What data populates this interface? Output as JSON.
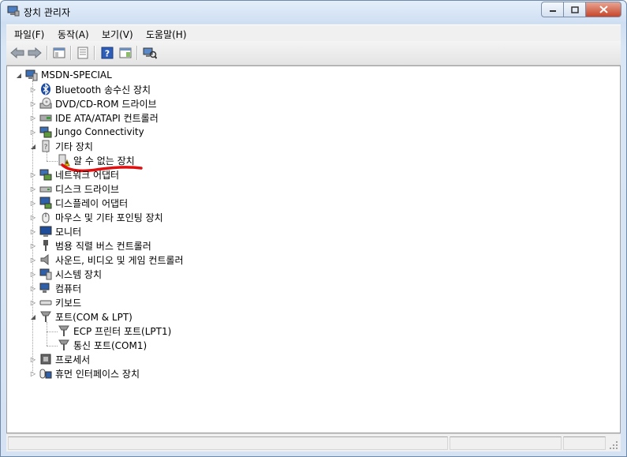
{
  "window": {
    "title": "장치 관리자",
    "btn_min": "0",
    "btn_max": "1",
    "btn_close": "r"
  },
  "menu": [
    "파일(F)",
    "동작(A)",
    "보기(V)",
    "도움말(H)"
  ],
  "colors": {
    "accent_red": "#e01010",
    "warning_yellow": "#f6c400"
  },
  "tree": {
    "root": {
      "label": "MSDN-SPECIAL",
      "icon": "computer-icon"
    },
    "items": [
      {
        "label": "Bluetooth 송수신 장치",
        "icon": "bluetooth-icon",
        "expanded": false
      },
      {
        "label": "DVD/CD-ROM 드라이브",
        "icon": "dvd-drive-icon",
        "expanded": false
      },
      {
        "label": "IDE ATA/ATAPI 컨트롤러",
        "icon": "ide-controller-icon",
        "expanded": false
      },
      {
        "label": "Jungo Connectivity",
        "icon": "network-icon",
        "expanded": false
      },
      {
        "label": "기타 장치",
        "icon": "other-device-icon",
        "expanded": true,
        "children": [
          {
            "label": "알 수 없는 장치",
            "icon": "warning-device-icon"
          }
        ]
      },
      {
        "label": "네트워크 어댑터",
        "icon": "network-adapter-icon",
        "expanded": false
      },
      {
        "label": "디스크 드라이브",
        "icon": "disk-drive-icon",
        "expanded": false
      },
      {
        "label": "디스플레이 어댑터",
        "icon": "display-adapter-icon",
        "expanded": false
      },
      {
        "label": "마우스 및 기타 포인팅 장치",
        "icon": "mouse-icon",
        "expanded": false
      },
      {
        "label": "모니터",
        "icon": "monitor-icon",
        "expanded": false
      },
      {
        "label": "범용 직렬 버스 컨트롤러",
        "icon": "usb-icon",
        "expanded": false
      },
      {
        "label": "사운드, 비디오 및 게임 컨트롤러",
        "icon": "speaker-icon",
        "expanded": false
      },
      {
        "label": "시스템 장치",
        "icon": "system-device-icon",
        "expanded": false
      },
      {
        "label": "컴퓨터",
        "icon": "computer-icon",
        "expanded": false
      },
      {
        "label": "키보드",
        "icon": "keyboard-icon",
        "expanded": false
      },
      {
        "label": "포트(COM & LPT)",
        "icon": "port-icon",
        "expanded": true,
        "children": [
          {
            "label": "ECP 프린터 포트(LPT1)",
            "icon": "port-icon"
          },
          {
            "label": "통신 포트(COM1)",
            "icon": "port-icon"
          }
        ]
      },
      {
        "label": "프로세서",
        "icon": "processor-icon",
        "expanded": false
      },
      {
        "label": "휴먼 인터페이스 장치",
        "icon": "hid-icon",
        "expanded": false
      }
    ]
  }
}
